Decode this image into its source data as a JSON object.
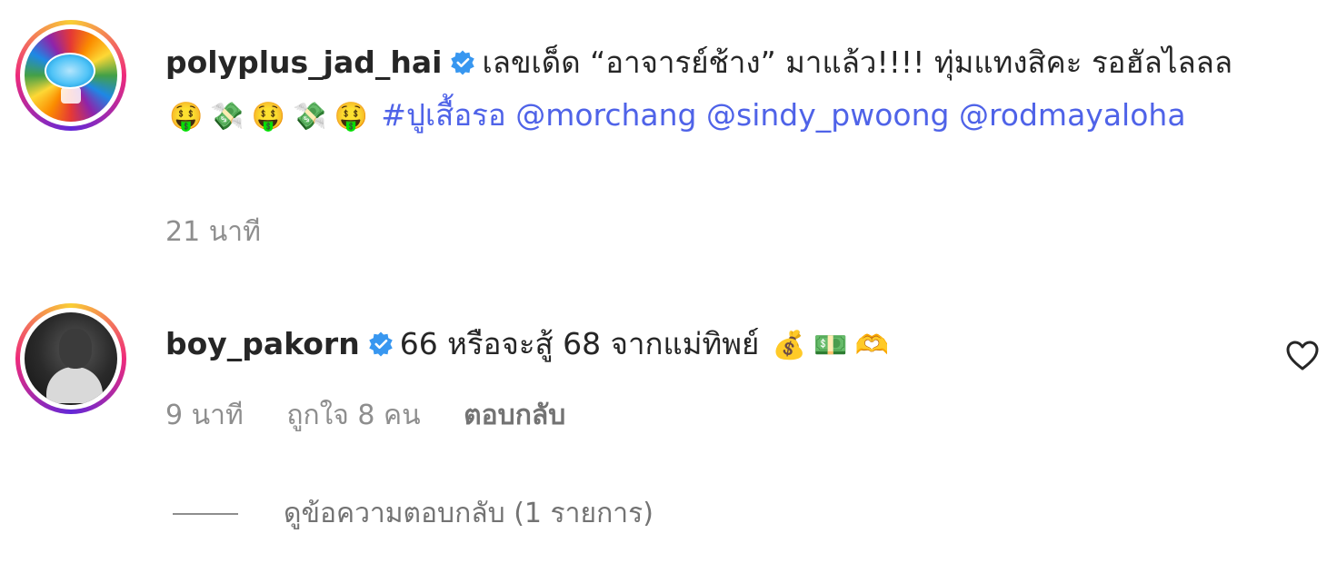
{
  "comments": [
    {
      "username": "polyplus_jad_hai",
      "verified": true,
      "avatar_icon": "spinning-wheel-logo",
      "text_main": "เลขเด็ด “อาจารย์ช้าง” มาแล้ว!!!! ทุ่มแทงสิคะ รอฮัลไลลล",
      "emojis": [
        "🤑",
        "💸",
        "🤑",
        "💸",
        "🤑"
      ],
      "hashtag": "#ปูเสื้อรอ",
      "mentions": [
        "@morchang",
        "@sindy_pwoong",
        "@rodmayaloha"
      ],
      "time": "21 นาที"
    },
    {
      "username": "boy_pakorn",
      "verified": true,
      "avatar_icon": "user-photo",
      "text_main": "66 หรือจะสู้ 68 จากแม่ทิพย์",
      "emojis": [
        "💰",
        "💵",
        "🫶"
      ],
      "time": "9 นาที",
      "likes": "ถูกใจ 8 คน",
      "reply_label": "ตอบกลับ"
    }
  ],
  "view_replies": "ดูข้อความตอบกลับ (1 รายการ)",
  "colors": {
    "link": "#4f63e8",
    "verified": "#3897f0",
    "muted": "#8e8e8e"
  }
}
